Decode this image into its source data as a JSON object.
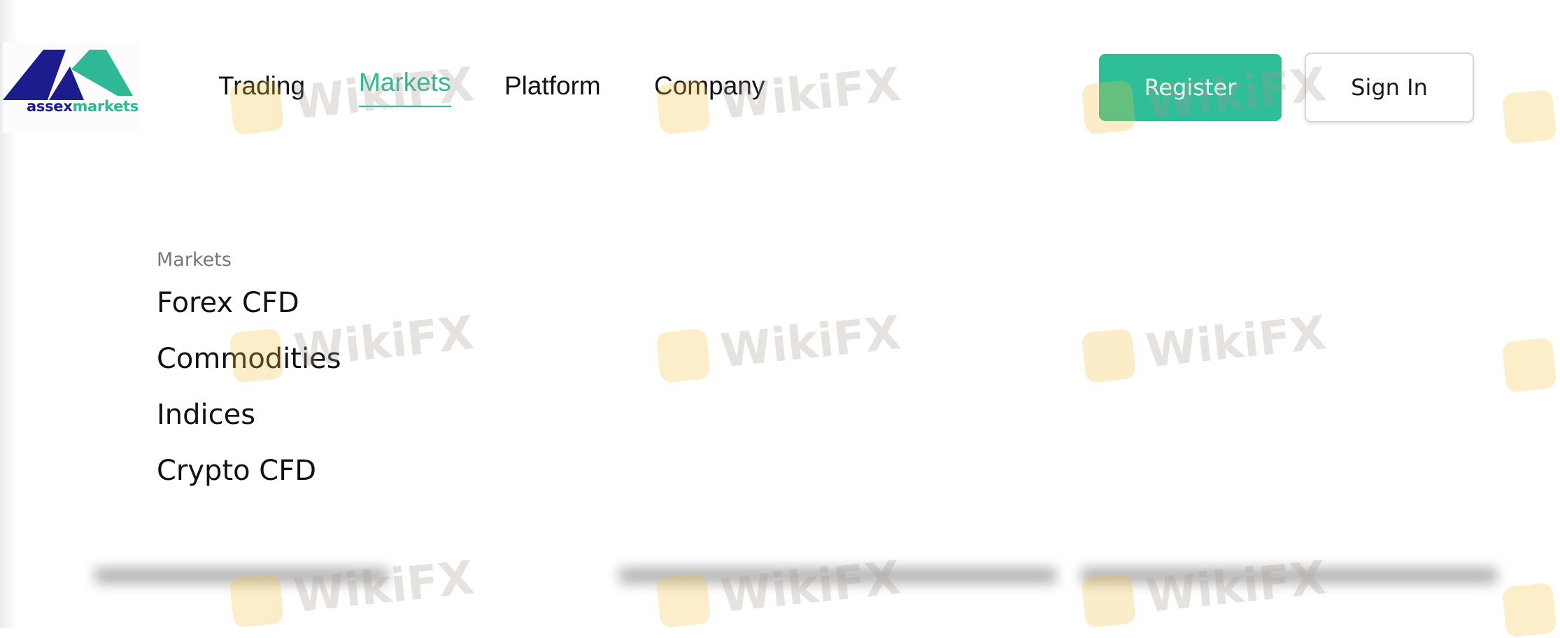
{
  "brand": {
    "logo_word_1": "assex",
    "logo_word_2": "markets",
    "color_dark": "#1c1c8f",
    "color_accent": "#2eb895"
  },
  "nav": {
    "items": [
      {
        "label": "Trading",
        "active": false
      },
      {
        "label": "Markets",
        "active": true
      },
      {
        "label": "Platform",
        "active": false
      },
      {
        "label": "Company",
        "active": false
      }
    ]
  },
  "actions": {
    "register_label": "Register",
    "signin_label": "Sign In"
  },
  "markets_menu": {
    "heading": "Markets",
    "links": [
      "Forex CFD",
      "Commodities",
      "Indices",
      "Crypto CFD"
    ]
  },
  "watermark": {
    "text": "WikiFX"
  }
}
